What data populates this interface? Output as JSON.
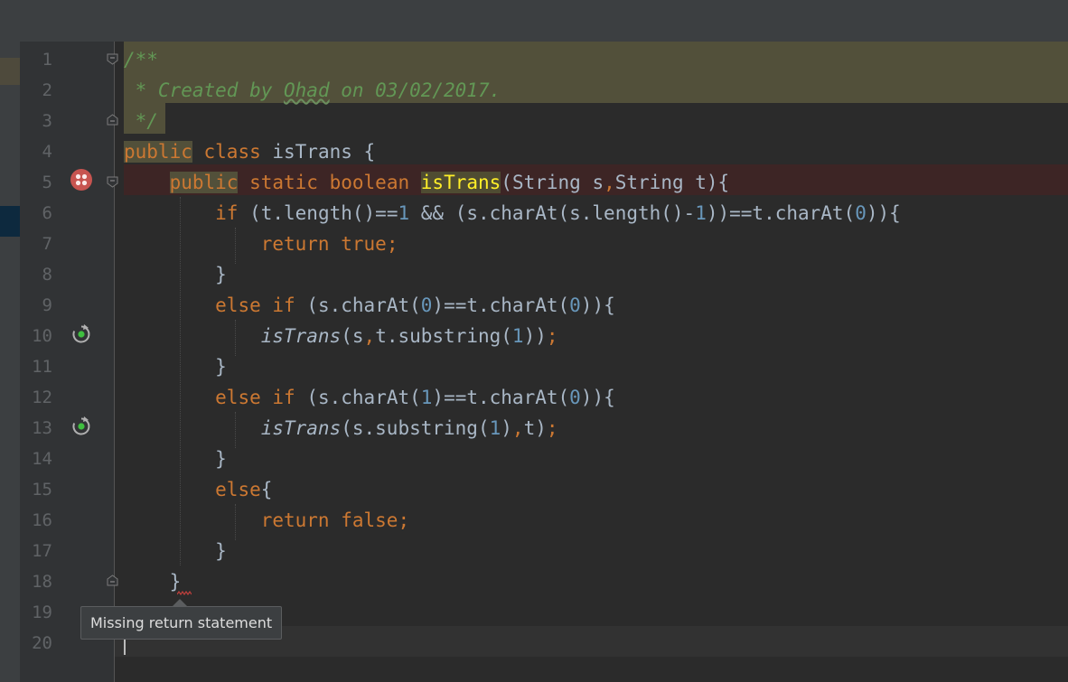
{
  "editor": {
    "line_numbers": [
      "1",
      "2",
      "3",
      "4",
      "5",
      "6",
      "7",
      "8",
      "9",
      "10",
      "11",
      "12",
      "13",
      "14",
      "15",
      "16",
      "17",
      "18",
      "19",
      "20"
    ],
    "line1": {
      "text": "/**"
    },
    "line2": {
      "prefix": " * Created by ",
      "author": "Ohad",
      "suffix": " on 03/02/2017."
    },
    "line3": {
      "text": " */"
    },
    "line4": {
      "kw_public": "public",
      "kw_class": "class",
      "rest": " isTrans {"
    },
    "line5": {
      "kw_public": "public",
      "kw_static": "static",
      "kw_boolean": "boolean",
      "method": "isTrans",
      "params_a": "(String s",
      "comma": ",",
      "params_b": "String t){"
    },
    "line6": {
      "kw_if": "if",
      "p1": " (t.length()==",
      "n1": "1",
      "p2": " && (s.charAt(s.length()-",
      "n2": "1",
      "p3": "))==t.charAt(",
      "n3": "0",
      "p4": ")){"
    },
    "line7": {
      "kw_return": "return",
      "kw_true": "true",
      "semi": ";"
    },
    "line8": {
      "text": "}"
    },
    "line9": {
      "kw_else": "else",
      "kw_if": "if",
      "p1": " (s.charAt(",
      "n1": "0",
      "p2": ")==t.charAt(",
      "n2": "0",
      "p3": ")){"
    },
    "line10": {
      "call": "isTrans",
      "p1": "(s",
      "comma": ",",
      "p2": "t.substring(",
      "n1": "1",
      "p3": "))",
      "semi": ";"
    },
    "line11": {
      "text": "}"
    },
    "line12": {
      "kw_else": "else",
      "kw_if": "if",
      "p1": " (s.charAt(",
      "n1": "1",
      "p2": ")==t.charAt(",
      "n2": "0",
      "p3": ")){"
    },
    "line13": {
      "call": "isTrans",
      "p1": "(s.substring(",
      "n1": "1",
      "p2": ")",
      "comma": ",",
      "p3": "t)",
      "semi": ";"
    },
    "line14": {
      "text": "}"
    },
    "line15": {
      "kw_else": "else",
      "rest": "{"
    },
    "line16": {
      "kw_return": "return",
      "kw_false": "false",
      "semi": ";"
    },
    "line17": {
      "text": "}"
    },
    "line18": {
      "text": "}"
    }
  },
  "tooltip": {
    "text": "Missing return statement"
  },
  "icons": {
    "breakpoint": "breakpoint-icon",
    "recursive_call": "recursive-call-icon",
    "fold": "fold-marker-icon"
  },
  "colors": {
    "background": "#2b2b2b",
    "keyword": "#cc7832",
    "comment": "#629755",
    "number": "#6897bb",
    "text": "#a9b7c6",
    "error_row": "#3d2525",
    "comment_highlight": "#52503a"
  }
}
